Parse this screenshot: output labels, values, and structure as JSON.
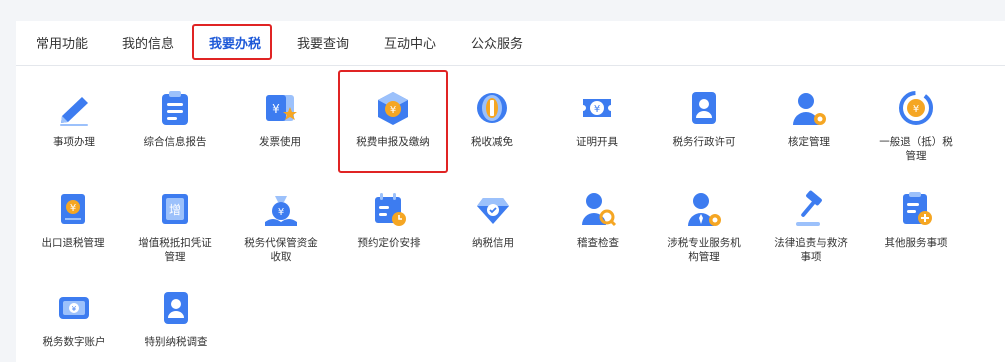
{
  "tabs": [
    {
      "label": "常用功能"
    },
    {
      "label": "我的信息"
    },
    {
      "label": "我要办税"
    },
    {
      "label": "我要查询"
    },
    {
      "label": "互动中心"
    },
    {
      "label": "公众服务"
    }
  ],
  "items": [
    {
      "label": "事项办理",
      "icon": "pen-icon"
    },
    {
      "label": "综合信息报告",
      "icon": "report-icon"
    },
    {
      "label": "发票使用",
      "icon": "invoice-icon"
    },
    {
      "label": "税费申报及缴纳",
      "icon": "tax-box-icon"
    },
    {
      "label": "税收减免",
      "icon": "coins-icon"
    },
    {
      "label": "证明开具",
      "icon": "ticket-icon"
    },
    {
      "label": "税务行政许可",
      "icon": "id-badge-icon"
    },
    {
      "label": "核定管理",
      "icon": "user-gear-icon"
    },
    {
      "label": "一般退（抵）税\n管理",
      "icon": "refund-cycle-icon"
    },
    {
      "label": "出口退税管理",
      "icon": "export-book-icon"
    },
    {
      "label": "增值税抵扣凭证\n管理",
      "icon": "vat-ticket-icon"
    },
    {
      "label": "税务代保管资金\n收取",
      "icon": "money-bag-icon"
    },
    {
      "label": "预约定价安排",
      "icon": "calendar-icon"
    },
    {
      "label": "纳税信用",
      "icon": "diamond-icon"
    },
    {
      "label": "稽查检查",
      "icon": "user-search-icon"
    },
    {
      "label": "涉税专业服务机\n构管理",
      "icon": "user-tie-gear-icon"
    },
    {
      "label": "法律追责与救济\n事项",
      "icon": "gavel-icon"
    },
    {
      "label": "其他服务事项",
      "icon": "clipboard-plus-icon"
    },
    {
      "label": "税务数字账户",
      "icon": "digital-account-icon"
    },
    {
      "label": "特别纳税调查",
      "icon": "special-id-icon"
    }
  ],
  "colors": {
    "primary": "#1f5ad8",
    "icon_blue": "#3d7cf0",
    "icon_light": "#9cc1fb",
    "accent_orange": "#f5a623",
    "highlight": "#e02424"
  }
}
